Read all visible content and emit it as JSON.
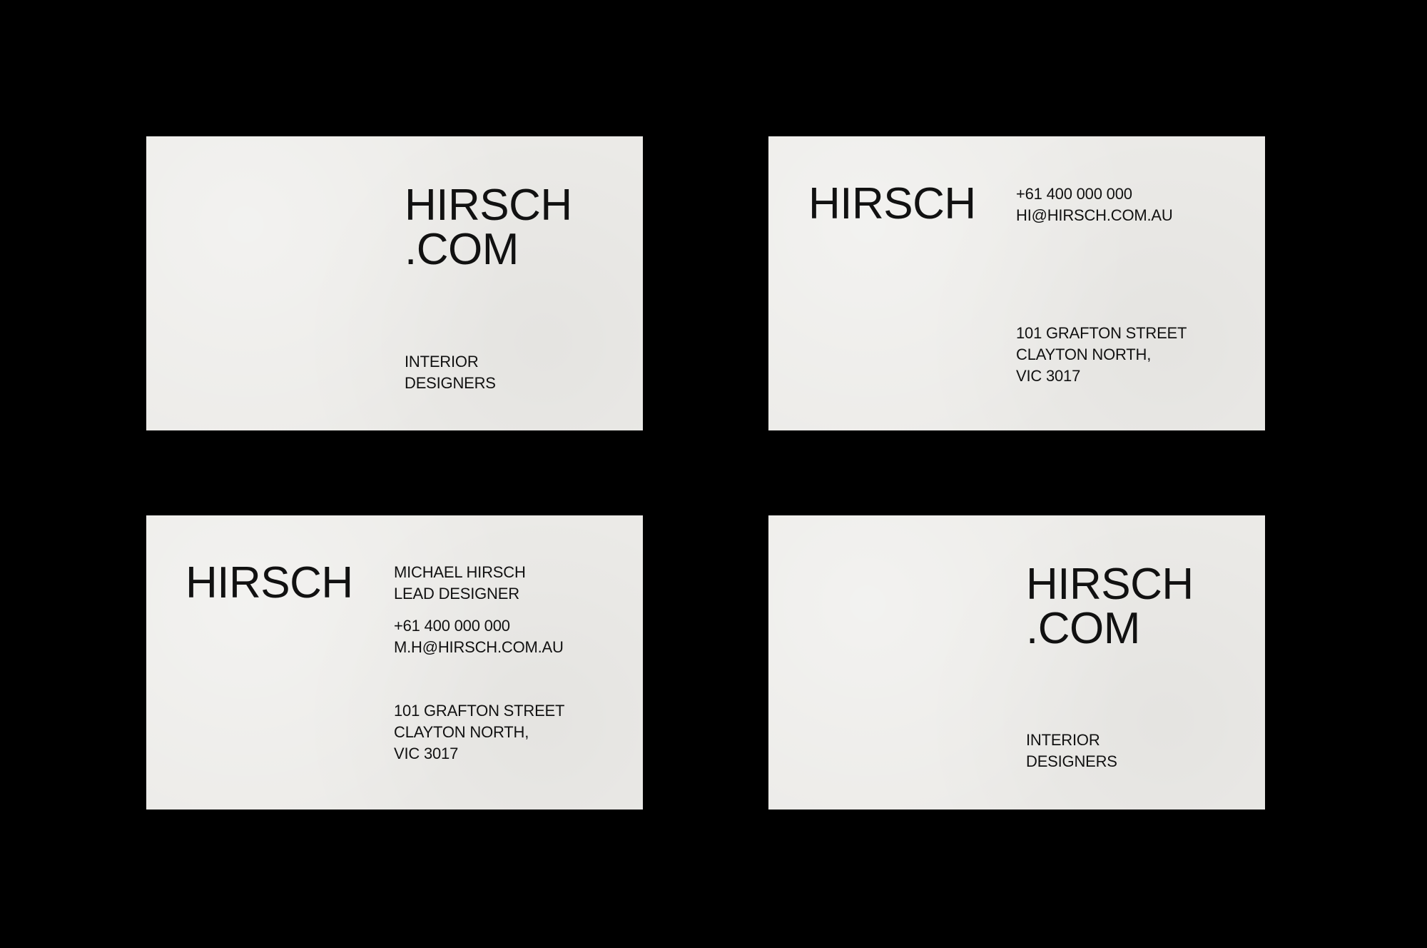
{
  "cards": [
    {
      "logo": [
        "HIRSCH",
        ".COM"
      ],
      "tagline": [
        "INTERIOR",
        "DESIGNERS"
      ]
    },
    {
      "logo": "HIRSCH",
      "contact": [
        "+61 400 000 000",
        "HI@HIRSCH.COM.AU"
      ],
      "address": [
        "101 GRAFTON STREET",
        "CLAYTON NORTH,",
        "VIC 3017"
      ]
    },
    {
      "logo": "HIRSCH",
      "person": [
        "MICHAEL HIRSCH",
        "LEAD DESIGNER"
      ],
      "contact": [
        "+61 400 000 000",
        "M.H@HIRSCH.COM.AU"
      ],
      "address": [
        "101 GRAFTON STREET",
        "CLAYTON NORTH,",
        "VIC 3017"
      ]
    },
    {
      "logo": [
        "HIRSCH",
        ".COM"
      ],
      "tagline": [
        "INTERIOR",
        "DESIGNERS"
      ]
    }
  ],
  "colors": {
    "background": "#000000",
    "card": "#ecebe8",
    "ink": "#111111"
  }
}
